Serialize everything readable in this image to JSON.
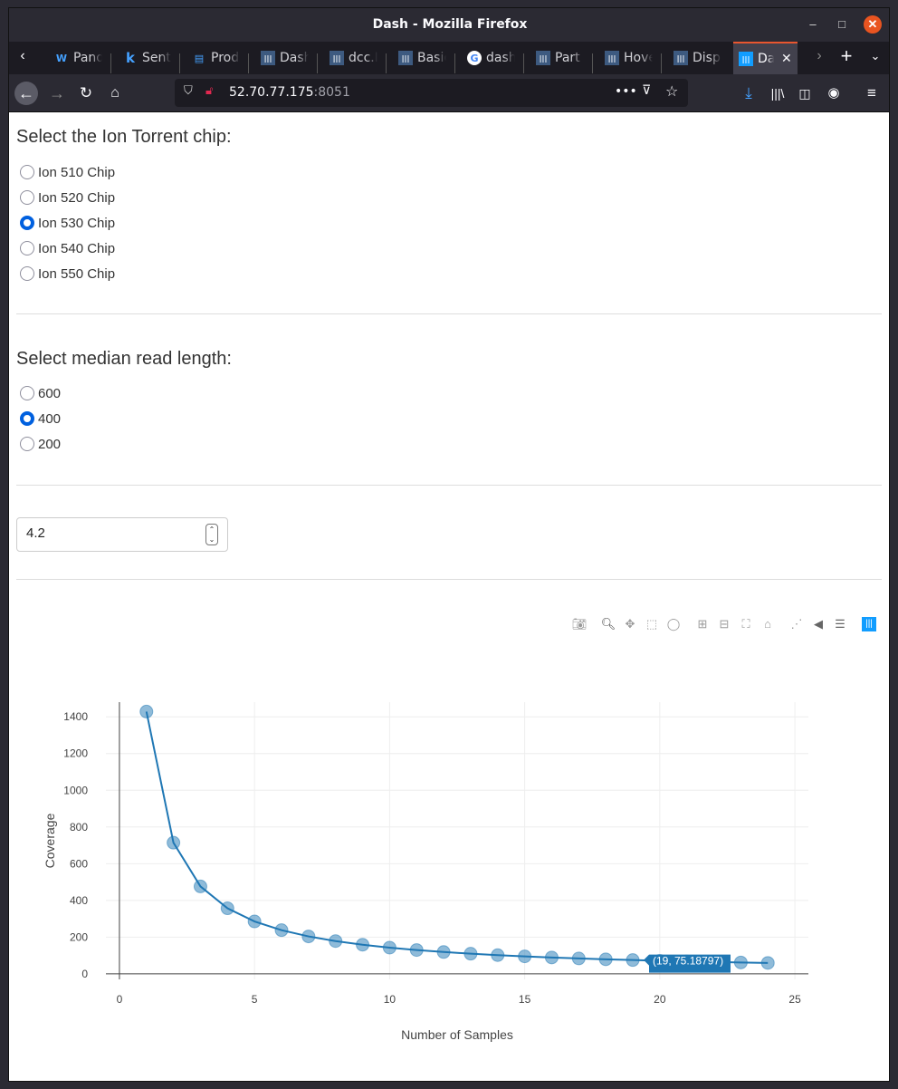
{
  "browser": {
    "window_title": "Dash - Mozilla Firefox",
    "tabs": [
      {
        "label": "Pand",
        "icon": "W"
      },
      {
        "label": "Sent",
        "icon": "k"
      },
      {
        "label": "Prod",
        "icon": "book"
      },
      {
        "label": "Dash",
        "icon": "plotly"
      },
      {
        "label": "dcc.I",
        "icon": "plotly"
      },
      {
        "label": "Basic",
        "icon": "plotly"
      },
      {
        "label": "dash",
        "icon": "G"
      },
      {
        "label": "Part",
        "icon": "plotly"
      },
      {
        "label": "Hove",
        "icon": "plotly"
      },
      {
        "label": "Displ",
        "icon": "plotly"
      },
      {
        "label": "Da",
        "icon": "plotly-active"
      }
    ],
    "url_host": "52.70.77.175",
    "url_port": ":8051"
  },
  "form": {
    "chip_heading": "Select the Ion Torrent chip:",
    "chip_options": [
      "Ion 510 Chip",
      "Ion 520 Chip",
      "Ion 530 Chip",
      "Ion 540 Chip",
      "Ion 550 Chip"
    ],
    "chip_selected": "Ion 530 Chip",
    "read_heading": "Select median read length:",
    "read_options": [
      "600",
      "400",
      "200"
    ],
    "read_selected": "400",
    "number_value": "4.2"
  },
  "accent_color": "#1f77b4",
  "chart_data": {
    "type": "line",
    "xlabel": "Number of Samples",
    "ylabel": "Coverage",
    "xlim": [
      -0.5,
      25.5
    ],
    "ylim": [
      -30,
      1480
    ],
    "x_ticks": [
      0,
      5,
      10,
      15,
      20,
      25
    ],
    "y_ticks": [
      0,
      200,
      400,
      600,
      800,
      1000,
      1200,
      1400
    ],
    "x": [
      1,
      2,
      3,
      4,
      5,
      6,
      7,
      8,
      9,
      10,
      11,
      12,
      13,
      14,
      15,
      16,
      17,
      18,
      19,
      20,
      21,
      22,
      23,
      24
    ],
    "y": [
      1428.57,
      714.29,
      476.19,
      357.14,
      285.71,
      238.1,
      204.08,
      178.57,
      158.73,
      142.86,
      129.87,
      119.05,
      109.89,
      102.04,
      95.24,
      89.29,
      84.03,
      79.37,
      75.19,
      71.43,
      68.03,
      64.94,
      62.11,
      59.52
    ],
    "mode": "lines+markers",
    "hover_label": "(19, 75.18797)",
    "hover_index": 18,
    "grid": true
  }
}
